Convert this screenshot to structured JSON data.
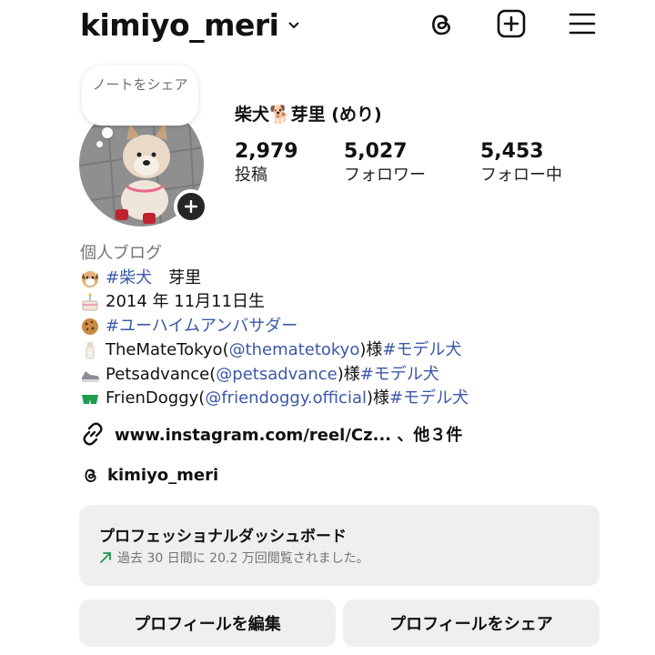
{
  "header": {
    "username": "kimiyo_meri"
  },
  "icons": {
    "threads": "threads-icon",
    "create": "plus-square-icon",
    "menu": "hamburger-menu-icon",
    "link": "link-icon"
  },
  "note": {
    "text": "ノートをシェア"
  },
  "profile": {
    "display_name": "柴犬🐕芽里 (めり)"
  },
  "stats": [
    {
      "value": "2,979",
      "label": "投稿"
    },
    {
      "value": "5,027",
      "label": "フォロワー"
    },
    {
      "value": "5,453",
      "label": "フォロー中"
    }
  ],
  "bio": {
    "category": "個人ブログ",
    "l1_tag": "#柴犬",
    "l1_text": "　芽里",
    "l2_text": "2014 年 11月11日生",
    "l3_tag": "#ユーハイムアンバサダー",
    "l4_pre": "TheMateTokyo(",
    "l4_handle": "@thematetokyo",
    "l4_mid": ")様",
    "l4_tag": "#モデル犬",
    "l5_pre": "Petsadvance(",
    "l5_handle": "@petsadvance",
    "l5_mid": ")様",
    "l5_tag": "#モデル犬",
    "l6_pre": "FrienDoggy(",
    "l6_handle": "@friendoggy.official",
    "l6_mid": ")様",
    "l6_tag": "#モデル犬"
  },
  "link": {
    "text": "www.instagram.com/reel/Cz... 、他３件"
  },
  "threads_link": {
    "text": "kimiyo_meri"
  },
  "dashboard": {
    "title": "プロフェッショナルダッシュボード",
    "subtitle": "過去 30 日間に 20.2 万回閲覧されました。"
  },
  "buttons": {
    "edit": "プロフィールを編集",
    "share": "プロフィールをシェア"
  },
  "colors": {
    "link_blue": "#3b58a8",
    "button_bg": "#efefef",
    "secondary_text": "#737373",
    "trend_green": "#1d9a4f"
  }
}
